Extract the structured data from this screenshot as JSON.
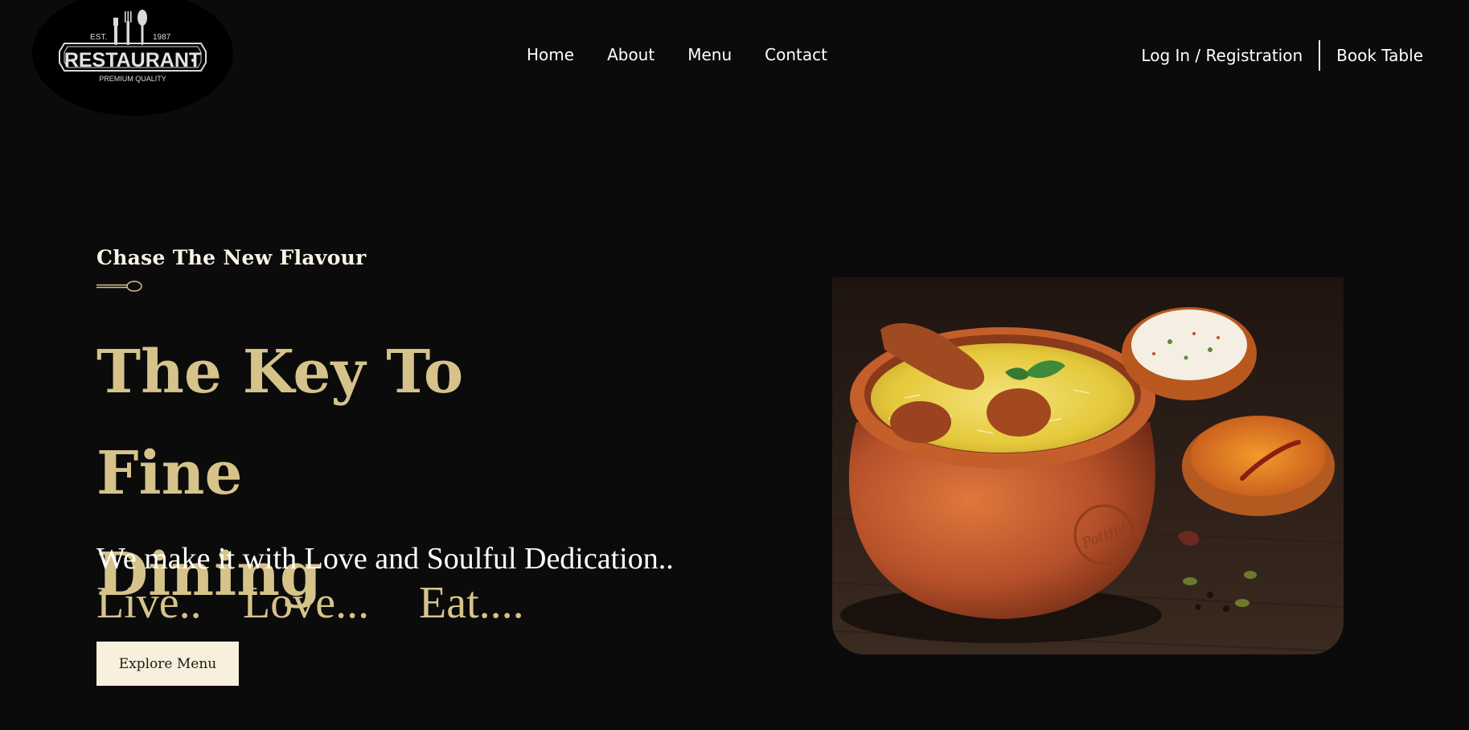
{
  "brand": {
    "logo_alt": "Restaurant logo",
    "logo_est": "EST.",
    "logo_year": "1987",
    "logo_name": "RESTAURANT",
    "logo_sub": "PREMIUM QUALITY"
  },
  "nav": {
    "items": [
      {
        "label": "Home"
      },
      {
        "label": "About"
      },
      {
        "label": "Menu"
      },
      {
        "label": "Contact"
      }
    ]
  },
  "actions": {
    "login_label": "Log In / Registration",
    "book_label": "Book Table"
  },
  "hero": {
    "kicker": "Chase The New Flavour",
    "headline_line1": "The Key To Fine",
    "headline_line2": "Dining",
    "tagline": "We make it with Love and Soulful Dedication..",
    "triad": [
      "Live..",
      "Love...",
      "Eat...."
    ],
    "cta_label": "Explore Menu",
    "image_emboss": "Pottful"
  },
  "colors": {
    "background": "#0b0b0c",
    "gold": "#d6c38a",
    "cream": "#f8efdc"
  }
}
